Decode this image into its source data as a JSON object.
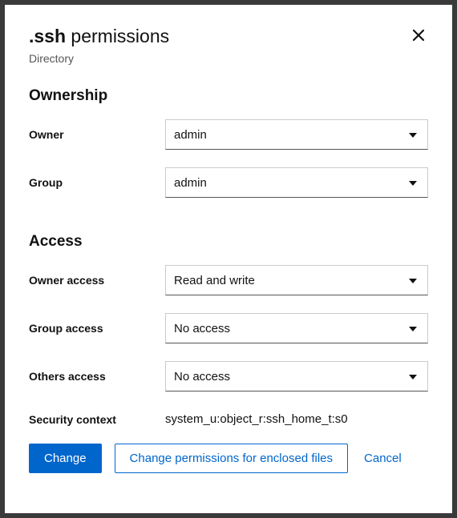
{
  "title_prefix": ".ssh",
  "title_suffix": " permissions",
  "subtitle": "Directory",
  "sections": {
    "ownership": {
      "heading": "Ownership",
      "owner_label": "Owner",
      "owner_value": "admin",
      "group_label": "Group",
      "group_value": "admin"
    },
    "access": {
      "heading": "Access",
      "owner_access_label": "Owner access",
      "owner_access_value": "Read and write",
      "group_access_label": "Group access",
      "group_access_value": "No access",
      "others_access_label": "Others access",
      "others_access_value": "No access",
      "security_context_label": "Security context",
      "security_context_value": "system_u:object_r:ssh_home_t:s0"
    }
  },
  "buttons": {
    "change": "Change",
    "change_enclosed": "Change permissions for enclosed files",
    "cancel": "Cancel"
  }
}
